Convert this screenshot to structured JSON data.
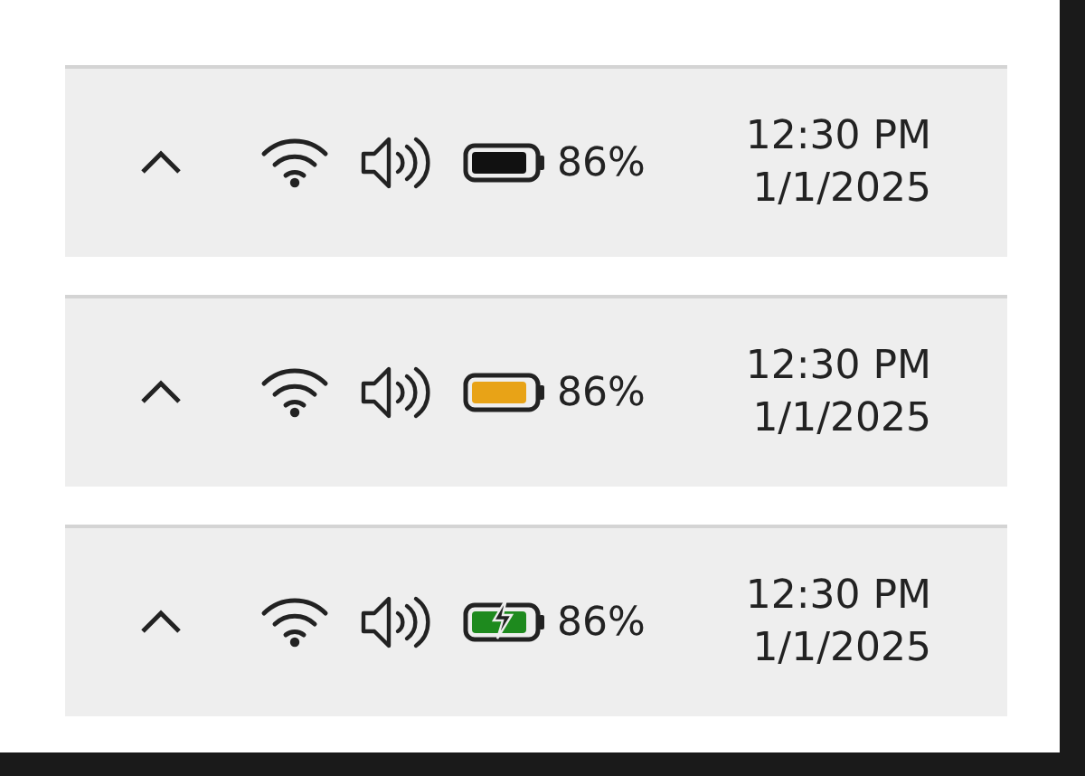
{
  "taskbars": [
    {
      "battery": {
        "kind": "discharging",
        "color": "#111111"
      },
      "percent": "86%",
      "time": "12:30 PM",
      "date": "1/1/2025"
    },
    {
      "battery": {
        "kind": "discharging",
        "color": "#e8a317"
      },
      "percent": "86%",
      "time": "12:30 PM",
      "date": "1/1/2025"
    },
    {
      "battery": {
        "kind": "charging",
        "color": "#1e8a1e"
      },
      "percent": "86%",
      "time": "12:30 PM",
      "date": "1/1/2025"
    }
  ]
}
